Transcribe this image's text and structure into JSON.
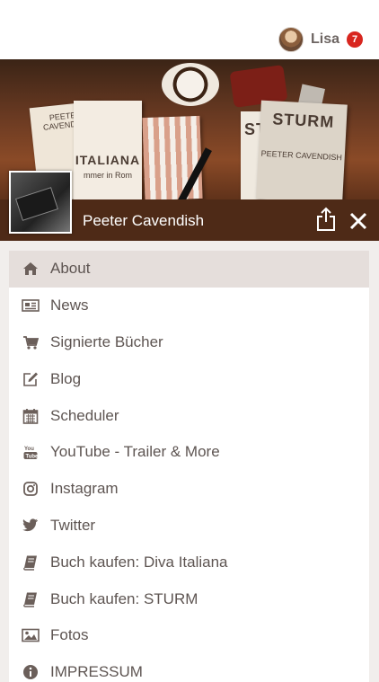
{
  "header": {
    "user_name": "Lisa",
    "notification_count": "7"
  },
  "cover": {
    "book_left_title": "PEETER CAVENDISH",
    "book_left_big": "ITALIANA",
    "book_left_sub": "mmer in Rom",
    "book_right_big": "STURM",
    "book_right_author": "PEETER CAVENDISH",
    "book_right_partial": "ST"
  },
  "page": {
    "name": "Peeter Cavendish"
  },
  "menu": {
    "items": [
      {
        "label": "About",
        "icon": "home-icon"
      },
      {
        "label": "News",
        "icon": "newspaper-icon"
      },
      {
        "label": "Signierte Bücher",
        "icon": "cart-icon"
      },
      {
        "label": "Blog",
        "icon": "edit-icon"
      },
      {
        "label": "Scheduler",
        "icon": "calendar-icon"
      },
      {
        "label": "YouTube - Trailer & More",
        "icon": "youtube-icon"
      },
      {
        "label": "Instagram",
        "icon": "instagram-icon"
      },
      {
        "label": "Twitter",
        "icon": "twitter-icon"
      },
      {
        "label": "Buch kaufen: Diva Italiana",
        "icon": "book-icon"
      },
      {
        "label": "Buch kaufen: STURM",
        "icon": "book-icon"
      },
      {
        "label": "Fotos",
        "icon": "image-icon"
      },
      {
        "label": "IMPRESSUM",
        "icon": "info-icon"
      }
    ]
  },
  "colors": {
    "banner": "#4e2a17",
    "active_item": "#e5dedb",
    "badge": "#d8261f",
    "icon": "#6b5f5a"
  }
}
